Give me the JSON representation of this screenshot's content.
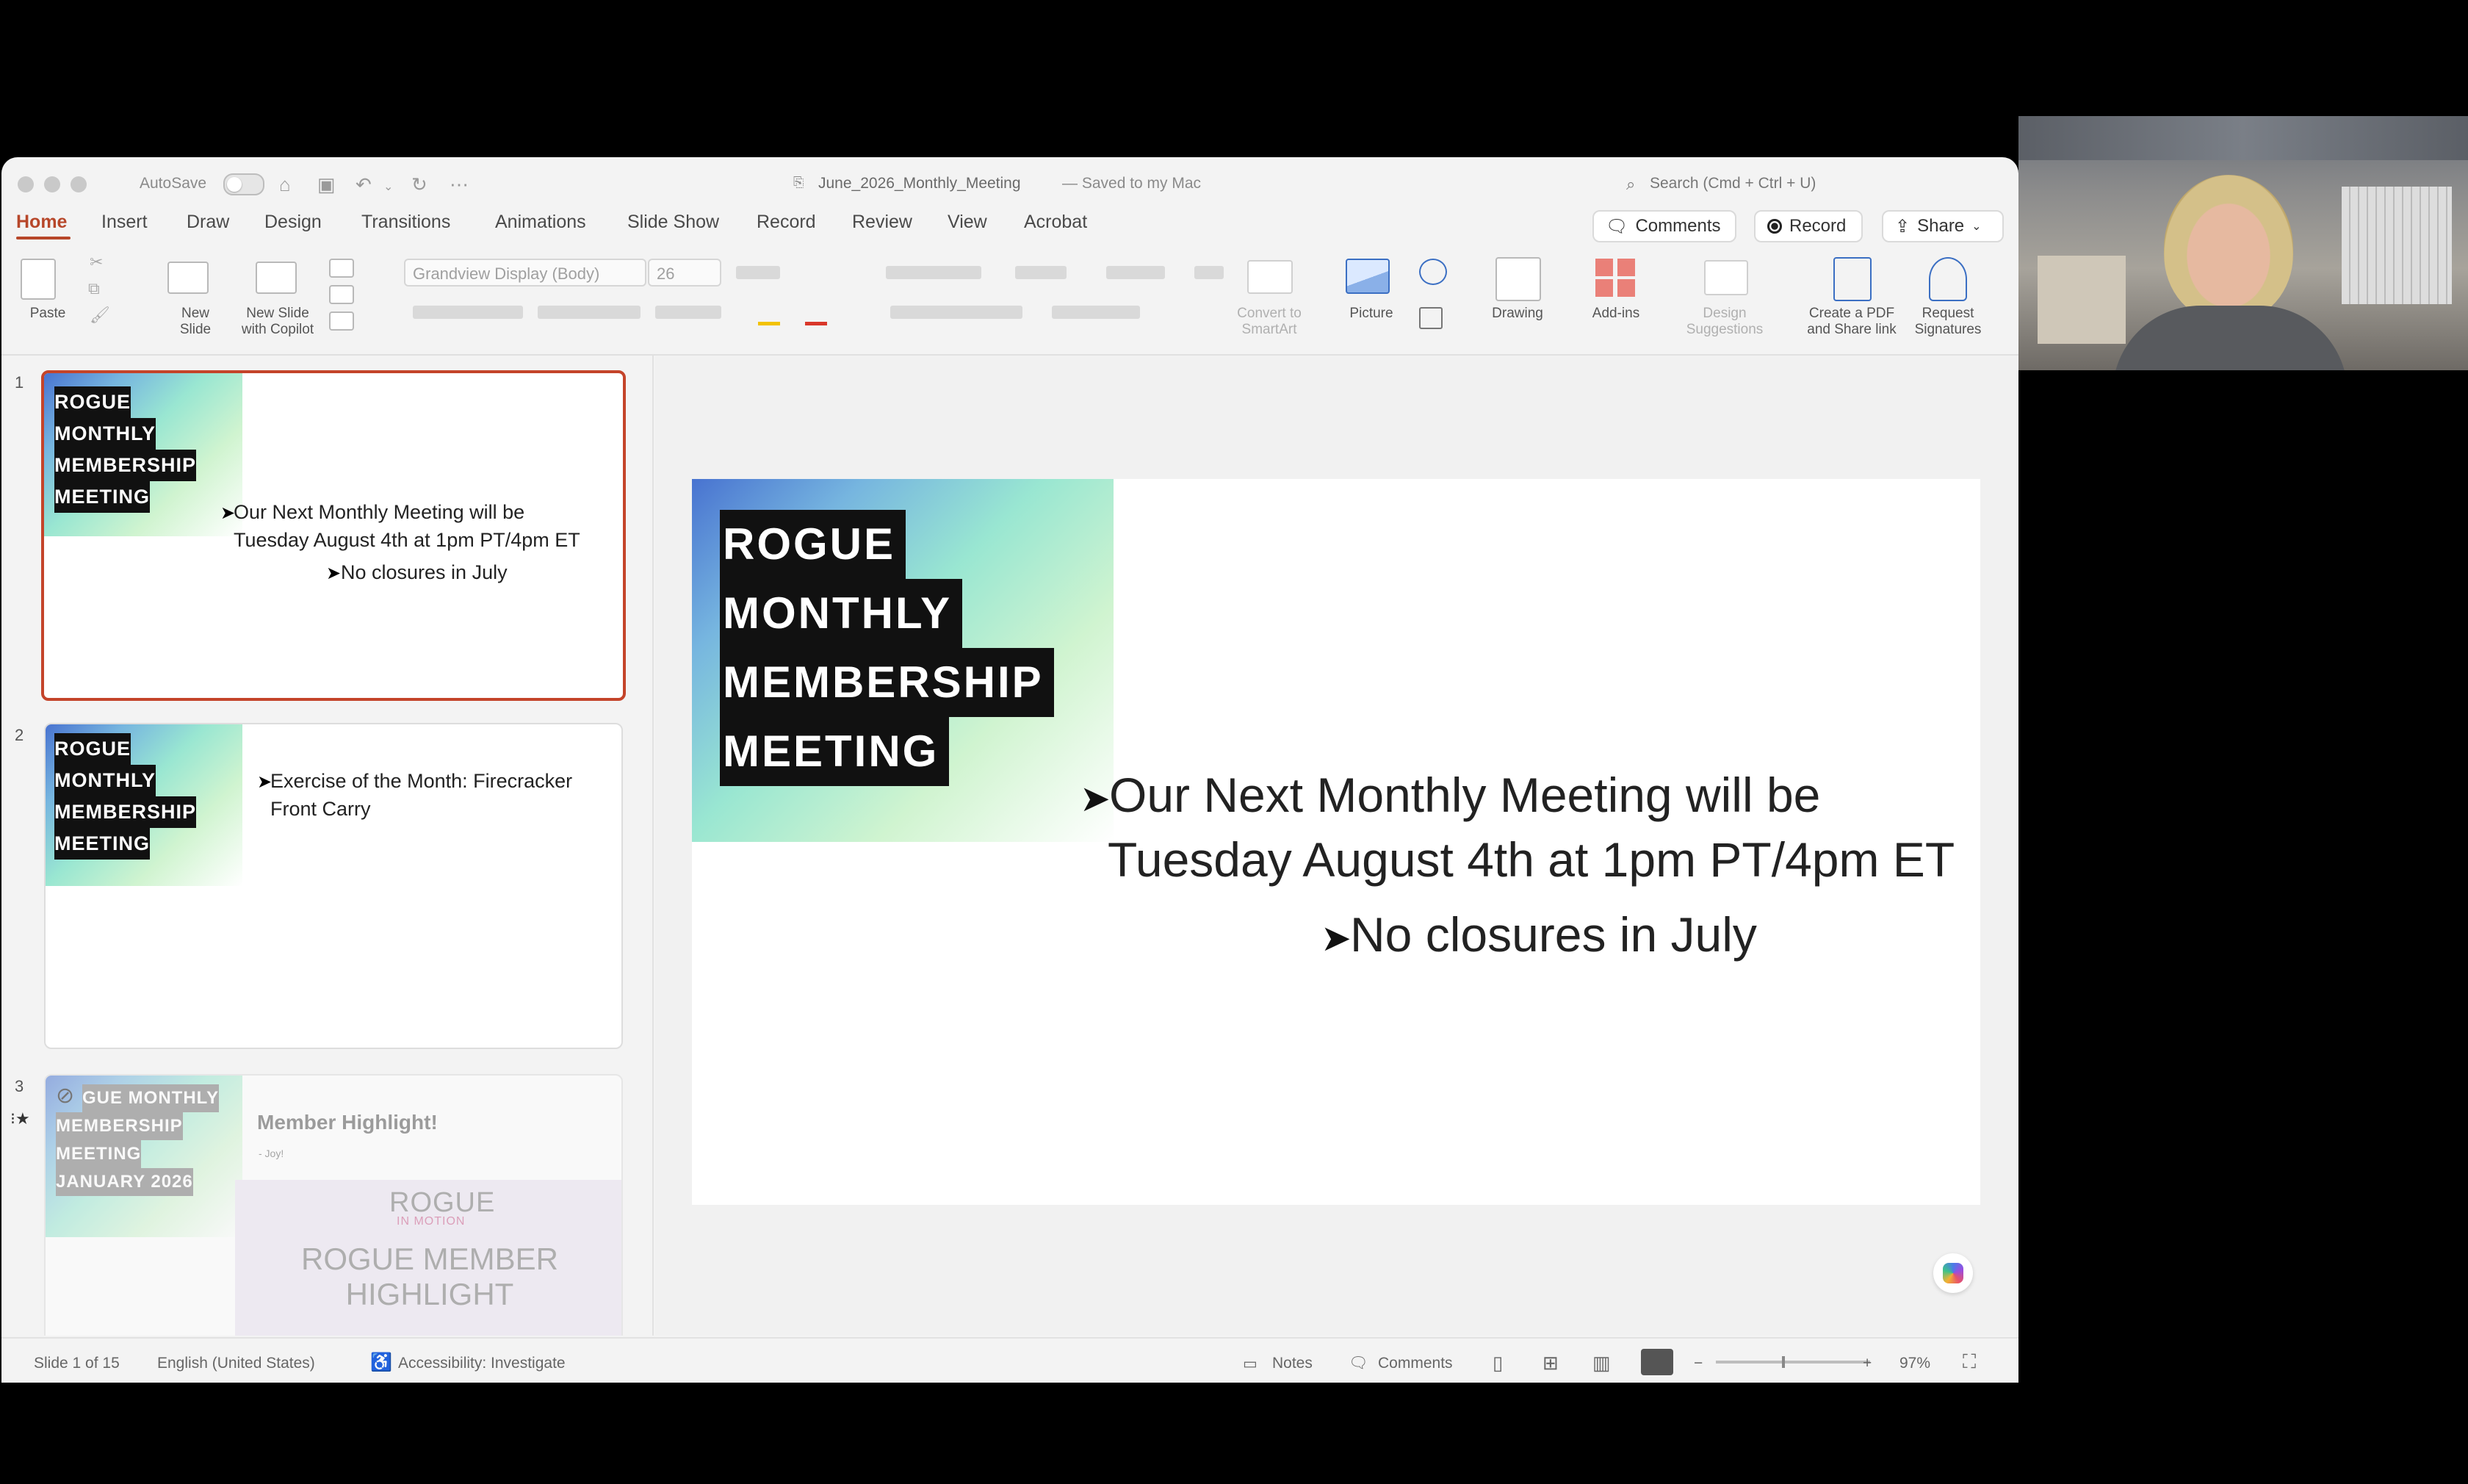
{
  "window": {
    "autosave_label": "AutoSave",
    "doc_title": "June_2026_Monthly_Meeting",
    "save_status": "— Saved to my Mac",
    "search_placeholder": "Search (Cmd + Ctrl + U)"
  },
  "tabs": [
    "Home",
    "Insert",
    "Draw",
    "Design",
    "Transitions",
    "Animations",
    "Slide Show",
    "Record",
    "Review",
    "View",
    "Acrobat"
  ],
  "actions": {
    "comments": "Comments",
    "record": "Record",
    "share": "Share"
  },
  "ribbon": {
    "paste": "Paste",
    "new_slide": "New\nSlide",
    "new_slide_copilot": "New Slide\nwith Copilot",
    "font_name": "Grandview Display (Body)",
    "font_size": "26",
    "convert_smartart": "Convert to\nSmartArt",
    "picture": "Picture",
    "drawing": "Drawing",
    "addins": "Add-ins",
    "design_suggestions": "Design\nSuggestions",
    "create_pdf": "Create a PDF\nand Share link",
    "request_signatures": "Request\nSignatures"
  },
  "slides": [
    {
      "number": "1",
      "header": [
        "ROGUE",
        "MONTHLY",
        "MEMBERSHIP",
        "MEETING"
      ],
      "bullet1_line1": "Our Next Monthly Meeting will be",
      "bullet1_line2": "Tuesday August 4th at 1pm PT/4pm ET",
      "bullet2": "No closures in July"
    },
    {
      "number": "2",
      "header": [
        "ROGUE",
        "MONTHLY",
        "MEMBERSHIP",
        "MEETING"
      ],
      "bullet1_line1": "Exercise of the Month: Firecracker",
      "bullet1_line2": "Front Carry"
    },
    {
      "number": "3",
      "header": [
        "GUE MONTHLY",
        "MEMBERSHIP",
        "MEETING",
        "JANUARY 2026"
      ],
      "title": "Member Highlight!",
      "sub": "- Joy!",
      "logo": "ROGUE",
      "logo_sub": "IN MOTION",
      "highlight_line1": "ROGUE MEMBER",
      "highlight_line2": "HIGHLIGHT"
    }
  ],
  "status": {
    "slide_count": "Slide 1 of 15",
    "language": "English (United States)",
    "accessibility": "Accessibility: Investigate",
    "notes": "Notes",
    "comments": "Comments",
    "zoom": "97%"
  },
  "icons": [
    "search-icon",
    "home-icon",
    "save-icon",
    "undo-icon",
    "redo-icon",
    "comment-icon",
    "record-icon",
    "share-icon",
    "copilot-icon",
    "notes-icon",
    "accessibility-icon"
  ]
}
